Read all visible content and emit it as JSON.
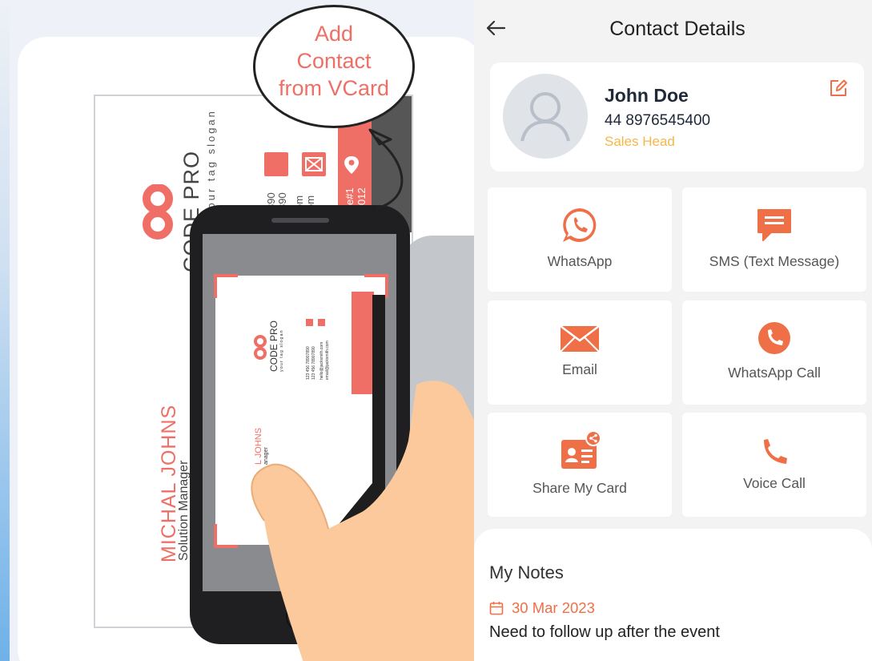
{
  "illustration": {
    "callout": [
      "Add",
      "Contact",
      "from VCard"
    ],
    "business_card": {
      "brand": "CODE PRO",
      "slogan": "your tag slogan",
      "name": "MICHAL JOHNS",
      "role": "Solution Manager",
      "phone_1": "890",
      "phone_2": "890",
      "email_1": "om",
      "email_2": "om",
      "address_1": "e#1",
      "address_2": "012"
    },
    "scanned_card": {
      "brand": "CODE PRO",
      "slogan": "your tag slogan",
      "phone_1": "123 456 78907890",
      "phone_2": "123 456 78907890",
      "email_1": "hello@jacksmith.com",
      "email_2": "email@jacksmith.com",
      "address_1": "address here, Suite#1",
      "address_2": "New Avenue, NY 012",
      "name": "L JOHNS",
      "role": "anager"
    }
  },
  "app": {
    "title": "Contact Details",
    "contact": {
      "name": "John Doe",
      "phone": "44 8976545400",
      "role": "Sales Head"
    },
    "actions": [
      {
        "label": "WhatsApp",
        "icon": "whatsapp-icon"
      },
      {
        "label": "SMS (Text Message)",
        "icon": "sms-icon"
      },
      {
        "label": "Email",
        "icon": "email-icon"
      },
      {
        "label": "WhatsApp Call",
        "icon": "phone-circle-icon"
      },
      {
        "label": "Share My Card",
        "icon": "share-card-icon"
      },
      {
        "label": "Voice Call",
        "icon": "phone-icon"
      }
    ],
    "notes": {
      "title": "My Notes",
      "date": "30 Mar 2023",
      "text": "Need to follow up after the event"
    },
    "colors": {
      "accent": "#ef6f47",
      "role": "#f5b64a",
      "card_red": "#ef6f66"
    }
  }
}
